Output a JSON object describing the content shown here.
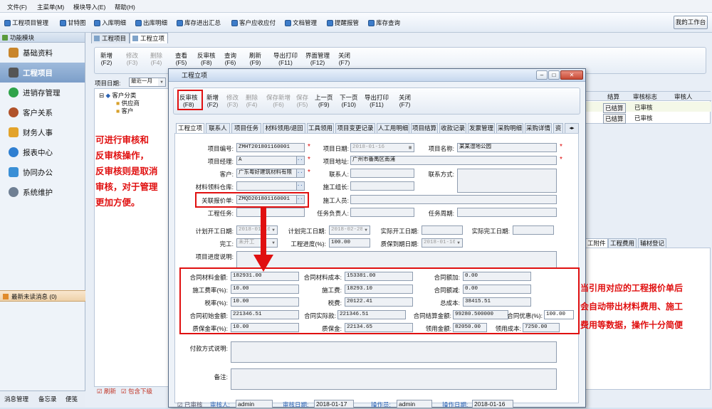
{
  "menubar": {
    "items": [
      "文件(F)",
      "主菜单(M)",
      "模块导入(E)",
      "帮助(H)"
    ]
  },
  "toolbar": {
    "items": [
      "工程项目管理",
      "甘特图",
      "入库明细",
      "出库明细",
      "库存进出汇总",
      "客户应收应付",
      "文档管理",
      "提醒报管",
      "库存查询"
    ],
    "my_work": "我的工作台"
  },
  "sidebar": {
    "header": "功能模块",
    "items": [
      "基础资料",
      "工程项目",
      "进销存管理",
      "客户关系",
      "财务人事",
      "报表中心",
      "协同办公",
      "系统维护"
    ],
    "unread": "最新未读消息 (0)",
    "bottom_tabs": [
      "消息管理",
      "备忘录",
      "便笺"
    ]
  },
  "bg": {
    "tabs": [
      "工程项目",
      "工程立项"
    ],
    "toolbar": [
      {
        "l": "新增",
        "k": "(F2)",
        "dis": false
      },
      {
        "l": "修改",
        "k": "(F3)",
        "dis": true
      },
      {
        "l": "删除",
        "k": "(F4)",
        "dis": true
      },
      {
        "l": "查看",
        "k": "(F5)",
        "dis": false
      },
      {
        "l": "反审核",
        "k": "(F8)",
        "dis": false
      },
      {
        "l": "查询",
        "k": "(F6)",
        "dis": false
      },
      {
        "l": "刷新",
        "k": "(F9)",
        "dis": false
      },
      {
        "l": "导出打印",
        "k": "(F11)",
        "dis": false
      },
      {
        "l": "界面管理",
        "k": "(F12)",
        "dis": false
      },
      {
        "l": "关闭",
        "k": "(F7)",
        "dis": false
      }
    ],
    "date_label": "项目日期:",
    "date_value": "最近一月",
    "tree": [
      "客户分类",
      "供应商",
      "客户"
    ],
    "table_headers": [
      "结算",
      "审核标志",
      "审核人"
    ],
    "table_rows": [
      [
        "已结算",
        "已审核",
        ""
      ],
      [
        "已结算",
        "已审核",
        ""
      ]
    ],
    "right_tabs": [
      "工附件",
      "工程费用",
      "辅材登记"
    ],
    "refresh": "刷新",
    "include_sub": "包含下级"
  },
  "dialog": {
    "title": "工程立项",
    "toolbar": [
      {
        "l": "反审核",
        "k": "(F8)",
        "dis": false
      },
      {
        "l": "新增",
        "k": "(F2)",
        "dis": false
      },
      {
        "l": "修改",
        "k": "(F3)",
        "dis": true
      },
      {
        "l": "删除",
        "k": "(F4)",
        "dis": true
      },
      {
        "l": "保存新增",
        "k": "(F6)",
        "dis": true
      },
      {
        "l": "保存",
        "k": "(F5)",
        "dis": true
      },
      {
        "l": "上一页",
        "k": "(F9)",
        "dis": false
      },
      {
        "l": "下一页",
        "k": "(F10)",
        "dis": false
      },
      {
        "l": "导出打印",
        "k": "(F11)",
        "dis": false
      },
      {
        "l": "关闭",
        "k": "(F7)",
        "dis": false
      }
    ],
    "subtabs": [
      "工程立项",
      "联系人",
      "项目任务",
      "材料领用/退回",
      "工具领用",
      "项目变更记录",
      "人工用明细",
      "项目结算",
      "收款记录",
      "发票管理",
      "采购明细",
      "采购详情",
      "资"
    ],
    "form": {
      "project_no": {
        "label": "项目编号:",
        "value": "ZMHT201801160001"
      },
      "project_date": {
        "label": "项目日期:",
        "value": "2018-01-16"
      },
      "project_name": {
        "label": "项目名称:",
        "value": "某某湿地公园"
      },
      "manager": {
        "label": "项目经理:",
        "value": "A"
      },
      "address": {
        "label": "项目地址:",
        "value": "广州市番禺区南浦"
      },
      "customer": {
        "label": "客户:",
        "value": "广东粤好建筑材料有限"
      },
      "contact": {
        "label": "联系人:",
        "value": ""
      },
      "contact_way": {
        "label": "联系方式:",
        "value": ""
      },
      "warehouse": {
        "label": "材料领料仓库:",
        "value": ""
      },
      "team_leader": {
        "label": "施工组长:",
        "value": ""
      },
      "quote": {
        "label": "关联报价单:",
        "value": "ZMQD201801160001"
      },
      "workers": {
        "label": "施工人员:",
        "value": ""
      },
      "task": {
        "label": "工程任务:",
        "value": ""
      },
      "task_owner": {
        "label": "任务负责人:",
        "value": ""
      },
      "task_period": {
        "label": "任务周期:",
        "value": ""
      },
      "plan_start": {
        "label": "计划开工日期:",
        "value": "2018-01-16"
      },
      "plan_end": {
        "label": "计划完工日期:",
        "value": "2018-02-28"
      },
      "actual_start": {
        "label": "实际开工日期:",
        "value": ""
      },
      "actual_end": {
        "label": "实际完工日期:",
        "value": ""
      },
      "completed": {
        "label": "完工:",
        "value": "未开工"
      },
      "progress": {
        "label": "工程进度(%):",
        "value": "100.00"
      },
      "warranty": {
        "label": "质保到期日期:",
        "value": "2018-01-16"
      },
      "progress_note": {
        "label": "项目进度说明:",
        "value": ""
      },
      "contract_material_amount": {
        "label": "合同材料金额:",
        "value": "182931.00"
      },
      "contract_material_cost": {
        "label": "合同材料成本:",
        "value": "153381.00"
      },
      "contract_add": {
        "label": "合同额加:",
        "value": "0.00"
      },
      "construction_rate": {
        "label": "施工费率(%):",
        "value": "10.00"
      },
      "construction_fee": {
        "label": "施工费:",
        "value": "18293.10"
      },
      "contract_reduce": {
        "label": "合同额减:",
        "value": "0.00"
      },
      "tax_rate": {
        "label": "税率(%):",
        "value": "10.00"
      },
      "tax": {
        "label": "税费:",
        "value": "20122.41"
      },
      "total_cost": {
        "label": "总成本:",
        "value": "38415.51"
      },
      "contract_initial": {
        "label": "合同初始金额:",
        "value": "221346.51"
      },
      "contract_actual": {
        "label": "合同实际款:",
        "value": "221346.51"
      },
      "contract_settle": {
        "label": "合同结算金额:",
        "value": "99280.500000"
      },
      "contract_discount": {
        "label": "合同优惠(%):",
        "value": "100.00"
      },
      "deposit_rate": {
        "label": "质保金率(%):",
        "value": "10.00"
      },
      "deposit": {
        "label": "质保金:",
        "value": "22134.65"
      },
      "used_amount": {
        "label": "领用金额:",
        "value": "82050.00"
      },
      "used_cost": {
        "label": "领用成本:",
        "value": "7250.00"
      },
      "payment_note": {
        "label": "付款方式说明:",
        "value": ""
      },
      "remark": {
        "label": "备注:",
        "value": ""
      }
    },
    "footer": {
      "audited": "已审核",
      "auditor_label": "审核人:",
      "auditor": "admin",
      "audit_date_label": "审核日期:",
      "audit_date": "2018-01-17",
      "operator_label": "操作员:",
      "operator": "admin",
      "op_date_label": "操作日期:",
      "op_date": "2018-01-16"
    }
  },
  "annotations": {
    "left": [
      "可进行审核和",
      "反审核操作，",
      "反审核则是取消",
      "审核，对于管理",
      "更加方便。"
    ],
    "right": [
      "当引用对应的工程报价单后",
      "会自动带出材料费用、施工",
      "费用等数据，操作十分简便"
    ]
  }
}
